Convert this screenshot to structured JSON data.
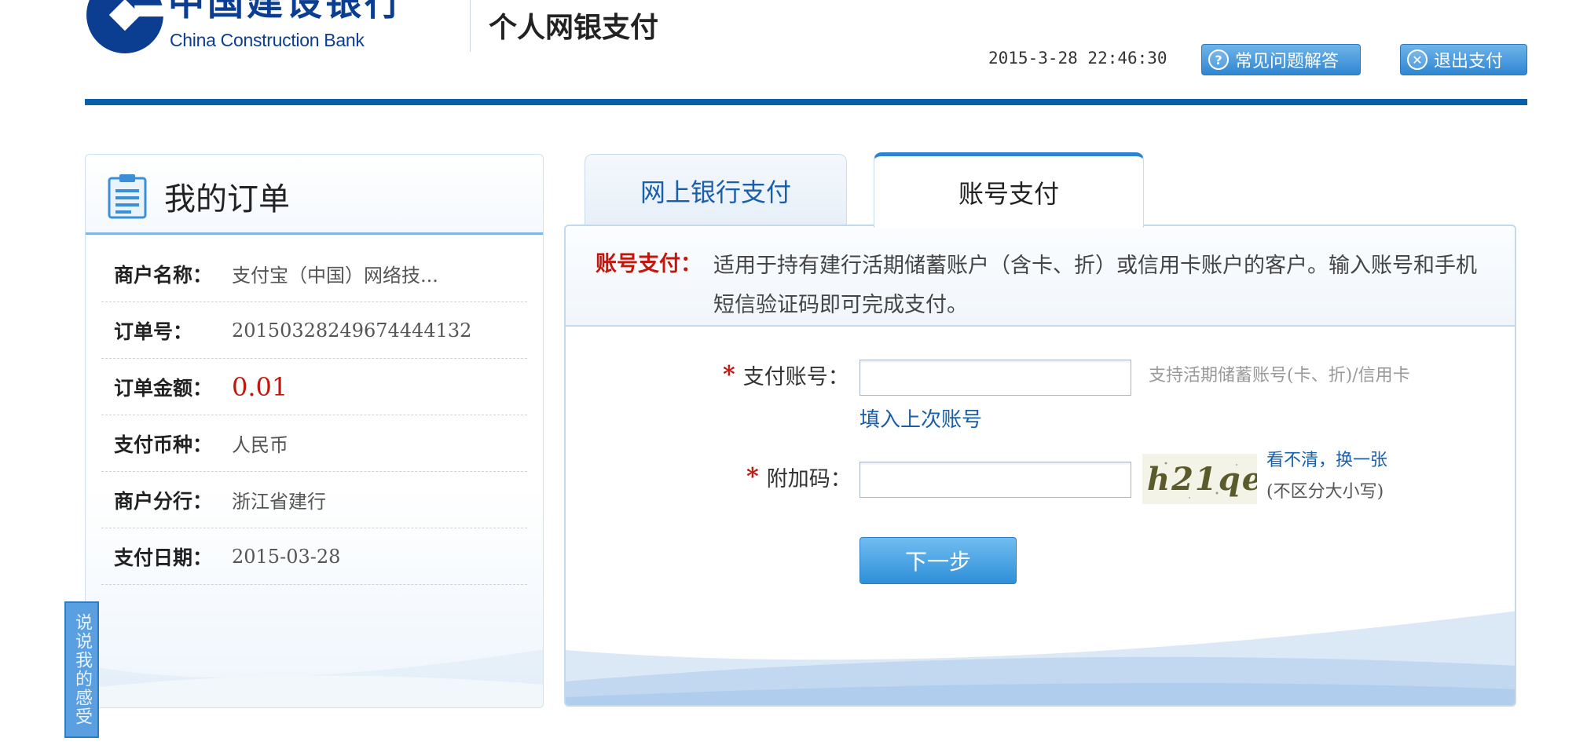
{
  "header": {
    "brand_cn": "中国建设银行",
    "brand_en": "China Construction Bank",
    "subtitle": "个人网银支付",
    "datetime": "2015-3-28 22:46:30",
    "faq_label": "常见问题解答",
    "exit_label": "退出支付",
    "brand_color": "#0a5fa8"
  },
  "order": {
    "title": "我的订单",
    "rows": [
      {
        "label": "商户名称：",
        "value": "支付宝（中国）网络技..."
      },
      {
        "label": "订单号：",
        "value": "20150328249674444132"
      },
      {
        "label": "订单金额：",
        "value": "0.01"
      },
      {
        "label": "支付币种：",
        "value": "人民币"
      },
      {
        "label": "商户分行：",
        "value": "浙江省建行"
      },
      {
        "label": "支付日期：",
        "value": "2015-03-28"
      }
    ],
    "amount_color": "#c0170f"
  },
  "feedback_tab": "说说我的感受",
  "tabs": [
    {
      "label": "网上银行支付",
      "active": false
    },
    {
      "label": "账号支付",
      "active": true
    }
  ],
  "payment": {
    "desc_label": "账号支付：",
    "desc_text": "适用于持有建行活期储蓄账户（含卡、折）或信用卡账户的客户。输入账号和手机短信验证码即可完成支付。",
    "account_label": "支付账号：",
    "account_value": "",
    "account_hint": "支持活期储蓄账号(卡、折)/信用卡",
    "fill_last": "填入上次账号",
    "captcha_label": "附加码：",
    "captcha_value": "",
    "captcha_text": "h21qe",
    "captcha_refresh": "看不清，换一张",
    "captcha_note": "(不区分大小写)",
    "next_label": "下一步",
    "required_mark": "*"
  }
}
